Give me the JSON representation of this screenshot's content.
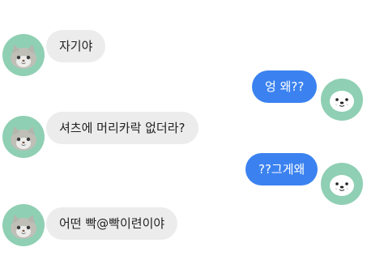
{
  "colors": {
    "incoming_bubble": "#ececec",
    "outgoing_bubble": "#3b82f0",
    "avatar_bg": "#8fcfb3"
  },
  "messages": [
    {
      "sender": "left",
      "avatar": "cat-face-icon",
      "text": "자기야"
    },
    {
      "sender": "right",
      "avatar": "seal-face-icon",
      "text": "엉 왜??"
    },
    {
      "sender": "left",
      "avatar": "cat-face-icon",
      "text": "셔츠에 머리카락 없더라?"
    },
    {
      "sender": "right",
      "avatar": "seal-face-icon",
      "text": "??그게왜"
    },
    {
      "sender": "left",
      "avatar": "cat-face-icon",
      "text": "어떤 빡@빡이련이야"
    }
  ]
}
